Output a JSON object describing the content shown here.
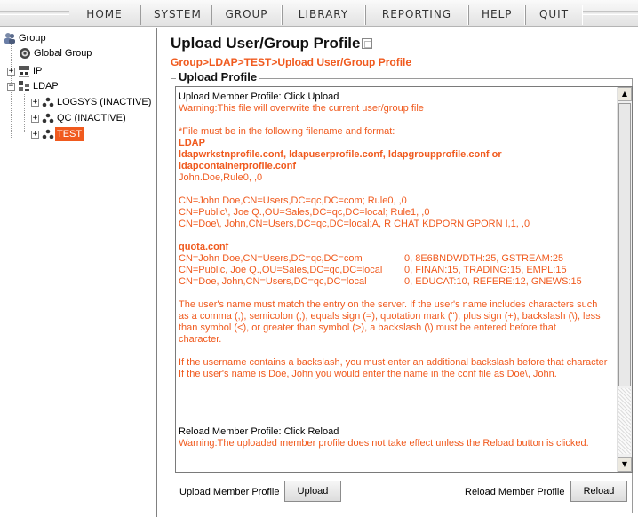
{
  "menu": [
    "HOME",
    "SYSTEM",
    "GROUP",
    "LIBRARY",
    "REPORTING",
    "HELP",
    "QUIT"
  ],
  "tree": {
    "root": "Group",
    "global_group": "Global Group",
    "ip": "IP",
    "ldap": "LDAP",
    "logsys": "LOGSYS (INACTIVE)",
    "qc": "QC (INACTIVE)",
    "test": "TEST"
  },
  "page": {
    "title": "Upload User/Group Profile",
    "breadcrumb": "Group>LDAP>TEST>Upload User/Group Profile",
    "legend": "Upload Profile"
  },
  "content": {
    "upload_heading": "Upload Member Profile:  Click Upload",
    "warning_upload": "Warning:This file will overwrite the current user/group file",
    "format_intro": "*File must be in the following filename and format:",
    "ldap_title": "LDAP",
    "ldap_files_1": "ldapwrkstnprofile.conf, ldapuserprofile.conf, ldapgroupprofile.conf or",
    "ldap_files_2": "ldapcontainerprofile.conf",
    "ex1": "John.Doe,Rule0, ,0",
    "ex2": "CN=John Doe,CN=Users,DC=qc,DC=com; Rule0, ,0",
    "ex3": "CN=Public\\, Joe Q.,OU=Sales,DC=qc,DC=local; Rule1, ,0",
    "ex4": "CN=Doe\\, John,CN=Users,DC=qc,DC=local;A, R CHAT KDPORN GPORN I,1, ,0",
    "quota_title": "quota.conf",
    "quota": [
      {
        "dn": "CN=John Doe,CN=Users,DC=qc,DC=com",
        "val": "0, 8E6BNDWDTH:25, GSTREAM:25"
      },
      {
        "dn": "CN=Public, Joe Q.,OU=Sales,DC=qc,DC=local",
        "val": "0, FINAN:15, TRADING:15, EMPL:15"
      },
      {
        "dn": "CN=Doe, John,CN=Users,DC=qc,DC=local",
        "val": "0, EDUCAT:10, REFERE:12, GNEWS:15"
      }
    ],
    "note1_1": "The user's name must match the entry on the server. If the user's name includes characters such",
    "note1_2": "as a comma (,), semicolon (;), equals sign (=), quotation mark (\"), plus sign (+), backslash (\\), less",
    "note1_3": "than symbol (<), or greater than symbol (>), a backslash (\\) must be entered before that",
    "note1_4": "character.",
    "note2_1": "If the username contains a backslash, you must enter an additional backslash before that character",
    "note2_2": "If the user's name is Doe, John you would enter the name in the conf file as Doe\\, John.",
    "reload_heading": "Reload Member Profile:  Click Reload",
    "warning_reload": "Warning:The uploaded member profile does not take effect unless the Reload button is clicked."
  },
  "footer": {
    "upload_label": "Upload Member Profile",
    "upload_button": "Upload",
    "reload_label": "Reload Member Profile",
    "reload_button": "Reload"
  },
  "colors": {
    "accent": "#f05a1e"
  }
}
